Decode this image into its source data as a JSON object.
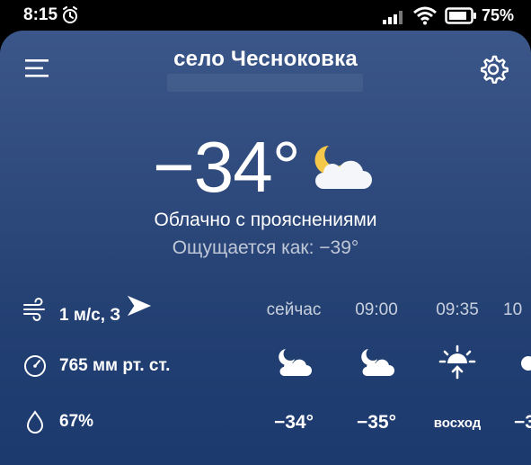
{
  "status": {
    "time": "8:15",
    "battery": "75%"
  },
  "header": {
    "location": "село Чесноковка"
  },
  "current": {
    "temperature": "−34°",
    "condition": "Облачно с прояснениями",
    "feels_like": "Ощущается как: −39°"
  },
  "details": {
    "wind": "1 м/с, З",
    "pressure": "765 мм рт. ст.",
    "humidity": "67%"
  },
  "hourly": [
    {
      "label": "сейчас",
      "icon": "moon-cloud-icon",
      "value": "−34°"
    },
    {
      "label": "09:00",
      "icon": "moon-cloud-icon",
      "value": "−35°"
    },
    {
      "label": "09:35",
      "icon": "sunrise-icon",
      "value": "восход"
    },
    {
      "label": "10",
      "icon": "sun-cloud-icon",
      "value": "−3"
    }
  ],
  "colors": {
    "bg_top": "#3b5688",
    "bg_bottom": "#1c3a6e",
    "moon": "#f5c84a"
  }
}
